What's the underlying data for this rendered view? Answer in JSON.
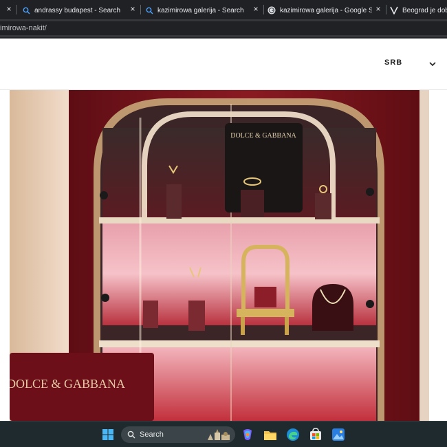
{
  "browser": {
    "tabs": [
      {
        "title": "andrassy budapest - Search",
        "favicon": "search-icon"
      },
      {
        "title": "kazimirowa galerija - Search",
        "favicon": "search-icon"
      },
      {
        "title": "kazimirowa galerija - Google Sear",
        "favicon": "google-icon"
      },
      {
        "title": "Beograd je dobi",
        "favicon": "vogue-icon"
      }
    ],
    "tab_close_glyph": "×",
    "partial_tab_close_glyph": "×",
    "address": "imirowa-nakit/"
  },
  "site": {
    "language": "SRB"
  },
  "hero": {
    "brand_top": "DOLCE & GABBANA",
    "brand_bottom": "DOLCE & GABBANA"
  },
  "taskbar": {
    "search_label": "Search",
    "icons": [
      "windows-start-icon",
      "copilot-icon",
      "file-explorer-icon",
      "edge-icon",
      "store-icon",
      "photos-icon"
    ]
  },
  "colors": {
    "tabstrip": "#202124",
    "accent_red": "#7a1319",
    "shelf_glow": "#f4c9cf",
    "gold": "#c9a24a",
    "taskbar": "#1f2a2f"
  }
}
